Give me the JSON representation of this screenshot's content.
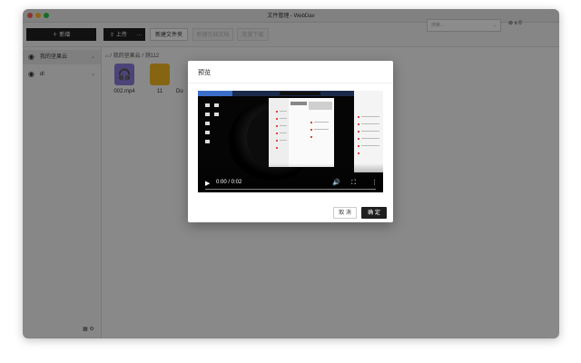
{
  "window": {
    "title": "文件管理 - WebDav"
  },
  "toolbar": {
    "new_label": "新增",
    "upload_label": "上传",
    "more_label": "···",
    "new_folder_label": "新建文件夹",
    "new_doc_label": "新建在线文档",
    "batch_download_label": "批量下载",
    "search_placeholder": "搜索...",
    "cloud_count": "x 0"
  },
  "sidebar": {
    "items": [
      {
        "label": "我的坚果云"
      },
      {
        "label": "dl"
      }
    ]
  },
  "breadcrumb": {
    "sep": "/",
    "root": "我的坚果云",
    "current": "测112"
  },
  "files": [
    {
      "name": "002.mp4"
    },
    {
      "name": "11"
    },
    {
      "name": "Do"
    }
  ],
  "modal": {
    "title": "预览",
    "video_time": "0:00 / 0:02",
    "cancel_label": "取 消",
    "ok_label": "确 定"
  },
  "colors": {
    "accent": "#1f1f1f",
    "file_icon_bg": "#8a7cdb",
    "folder": "#f5b822"
  }
}
